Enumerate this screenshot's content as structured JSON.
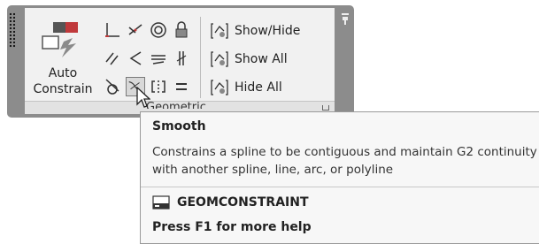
{
  "panel": {
    "title": "Geometric",
    "auto_constrain": {
      "line1": "Auto",
      "line2": "Constrain"
    },
    "constraint_icons": [
      "coincident-icon",
      "collinear-icon",
      "concentric-icon",
      "fix-icon",
      "parallel-icon",
      "perpendicular-icon",
      "horizontal-icon",
      "vertical-icon",
      "tangent-icon",
      "smooth-icon",
      "symmetric-icon",
      "equal-icon"
    ],
    "active_icon": "smooth-icon",
    "display_buttons": [
      {
        "label": "Show/Hide",
        "icon": "show-hide-icon"
      },
      {
        "label": "Show All",
        "icon": "show-all-icon"
      },
      {
        "label": "Hide All",
        "icon": "hide-all-icon"
      }
    ]
  },
  "tooltip": {
    "title": "Smooth",
    "description_line1": "Constrains a spline to be contiguous and maintain G2 continuity",
    "description_line2": "with another spline, line, arc, or polyline",
    "command": "GEOMCONSTRAINT",
    "help": "Press F1 for more help"
  }
}
